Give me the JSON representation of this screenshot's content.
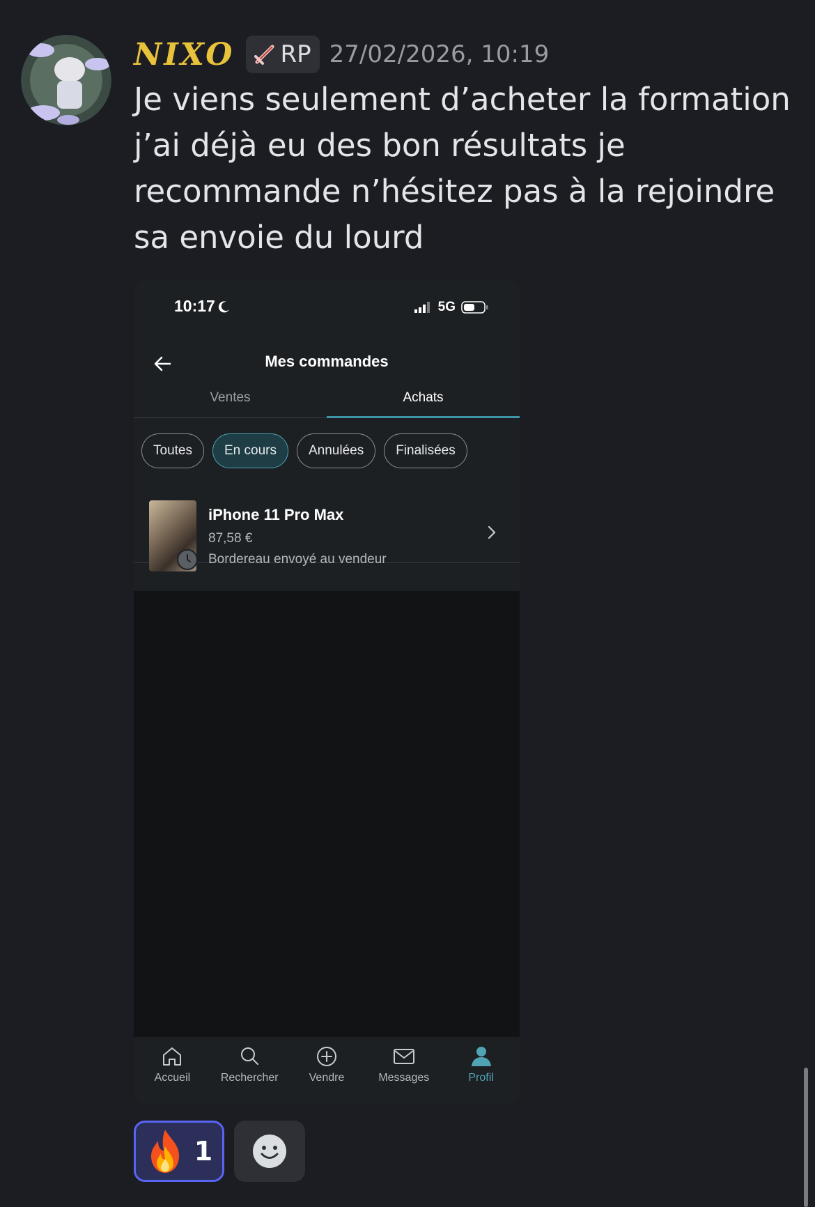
{
  "message": {
    "username": "NIXO",
    "role_tag": "RP",
    "role_icon": "sword-icon",
    "timestamp": "27/02/2026, 10:19",
    "text": "Je viens seulement d’acheter la formation j’ai déjà eu des bon résultats je recommande n’hésitez pas à la rejoindre sa envoie du lourd"
  },
  "phone": {
    "status_time": "10:17",
    "network": "5G",
    "nav_title": "Mes commandes",
    "tabs": [
      {
        "label": "Ventes",
        "active": false
      },
      {
        "label": "Achats",
        "active": true
      }
    ],
    "filters": [
      {
        "label": "Toutes",
        "active": false
      },
      {
        "label": "En cours",
        "active": true
      },
      {
        "label": "Annulées",
        "active": false
      },
      {
        "label": "Finalisées",
        "active": false
      }
    ],
    "order": {
      "title": "iPhone 11 Pro Max",
      "price": "87,58 €",
      "status": "Bordereau envoyé au vendeur"
    },
    "bottom_nav": [
      {
        "label": "Accueil",
        "icon": "home-icon",
        "active": false
      },
      {
        "label": "Rechercher",
        "icon": "search-icon",
        "active": false
      },
      {
        "label": "Vendre",
        "icon": "plus-circle-icon",
        "active": false
      },
      {
        "label": "Messages",
        "icon": "mail-icon",
        "active": false
      },
      {
        "label": "Profil",
        "icon": "profile-icon",
        "active": true
      }
    ],
    "accent_color": "#4fa3b5"
  },
  "reactions": [
    {
      "emoji": "🔥",
      "count": "1",
      "active": true
    },
    {
      "emoji": "add-reaction",
      "count": "",
      "active": false
    }
  ],
  "colors": {
    "background": "#1c1d22",
    "username": "#e8c23a",
    "reaction_active_border": "#5865f2"
  }
}
